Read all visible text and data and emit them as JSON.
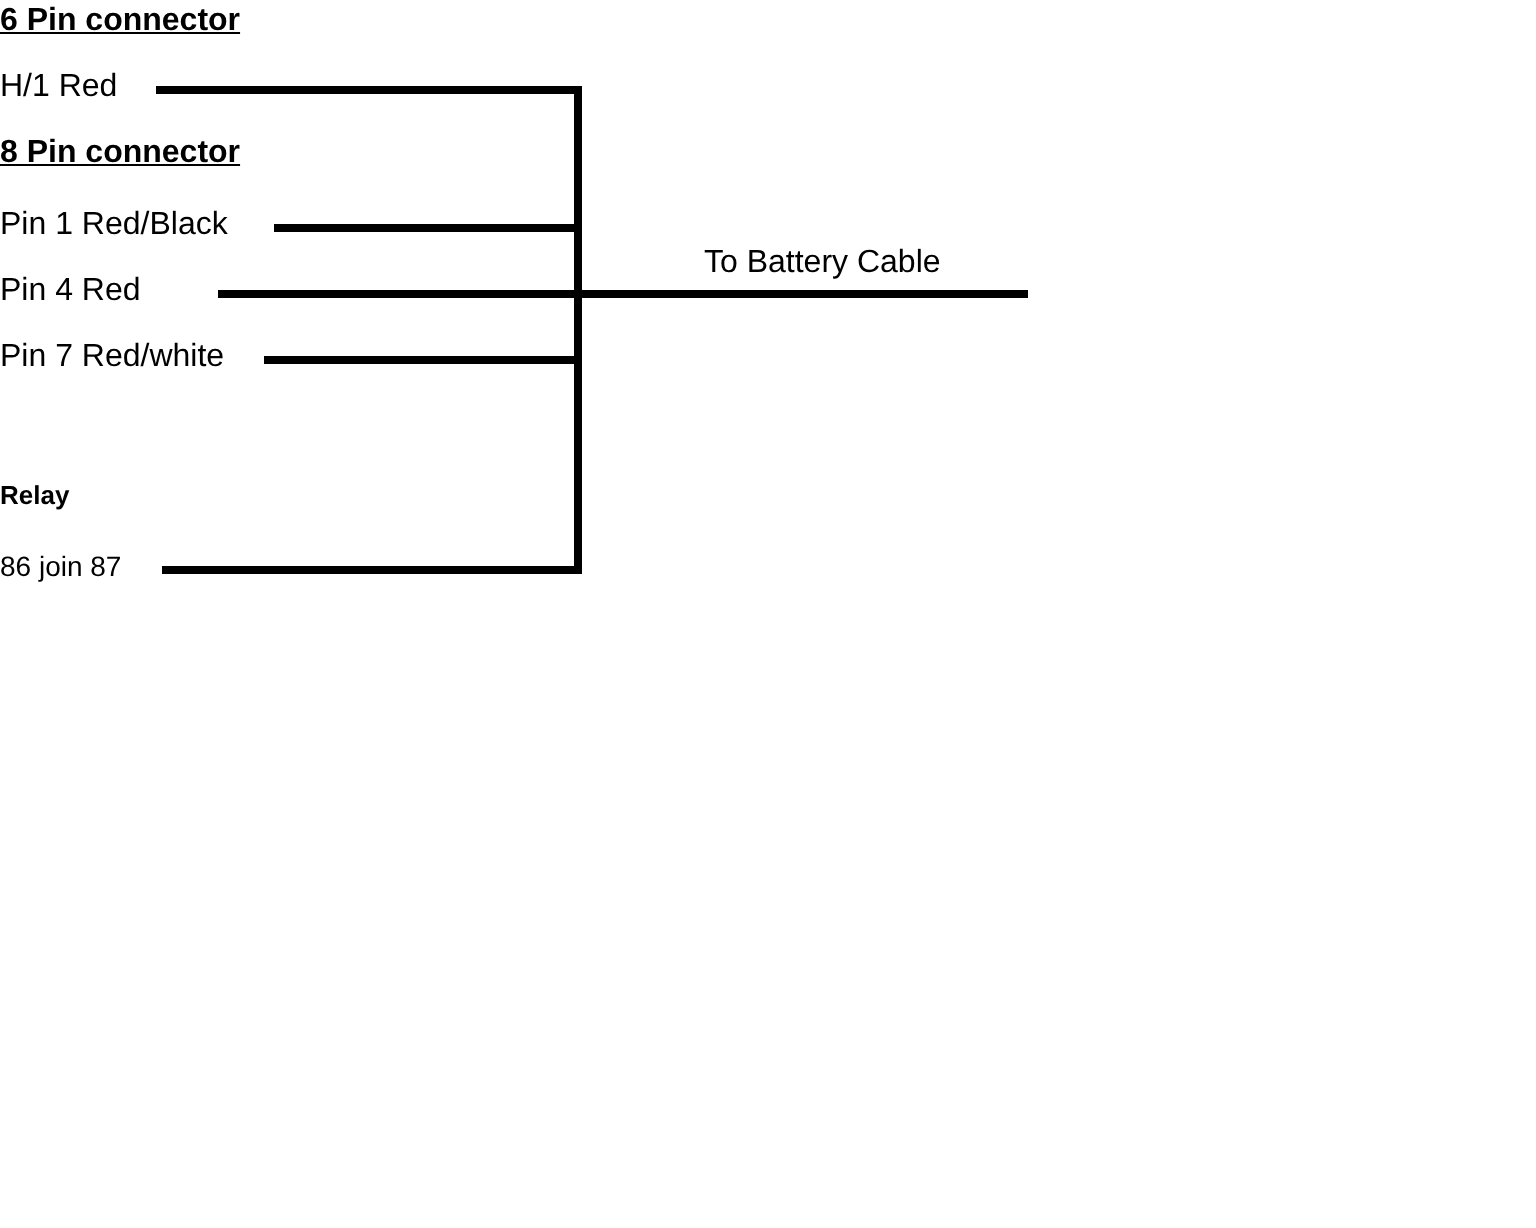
{
  "groups": [
    {
      "kind": "connector",
      "heading": "6 Pin connector",
      "wires": [
        {
          "label": "H/1 Red"
        }
      ]
    },
    {
      "kind": "connector",
      "heading": "8 Pin connector",
      "wires": [
        {
          "label": "Pin 1 Red/Black"
        },
        {
          "label": "Pin 4 Red"
        },
        {
          "label": "Pin 7 Red/white"
        }
      ]
    },
    {
      "kind": "relay",
      "heading": "Relay",
      "wires": [
        {
          "label": "86 join 87"
        }
      ]
    }
  ],
  "output": {
    "label": "To Battery Cable"
  }
}
